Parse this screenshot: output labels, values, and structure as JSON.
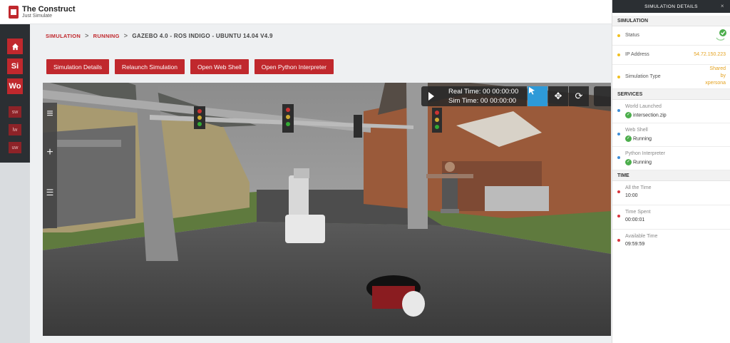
{
  "app": {
    "title": "The Construct",
    "subtitle": "Just Simulate"
  },
  "sidebar": {
    "home_icon": "home-icon",
    "workspaces": [
      {
        "label": "Si"
      },
      {
        "label": "Wo"
      }
    ],
    "shortcuts": [
      {
        "label": "sw"
      },
      {
        "label": "lw"
      },
      {
        "label": "uw"
      }
    ]
  },
  "breadcrumb": {
    "items": [
      "SIMULATION",
      "RUNNING"
    ],
    "current": "GAZEBO 4.0 - ROS INDIGO - UBUNTU 14.04 V4.9",
    "separator": ">"
  },
  "actions": [
    "Simulation Details",
    "Relaunch Simulation",
    "Open Web Shell",
    "Open Python Interpreter"
  ],
  "viewport": {
    "real_time": "Real Time: 00 00:00:00",
    "sim_time": "Sim Time: 00 00:00:00",
    "tools": [
      "menu-icon",
      "add-icon",
      "layers-icon"
    ],
    "toolbar": [
      "select-icon",
      "translate-icon",
      "rotate-icon"
    ]
  },
  "panel": {
    "title": "SIMULATION DETAILS",
    "close": "×",
    "sections": {
      "simulation": "SIMULATION",
      "services": "SERVICES",
      "time": "TIME"
    },
    "status_label": "Status",
    "ip_label": "IP Address",
    "ip_value": "54.72.150.223",
    "type_label": "Simulation Type",
    "type_value_1": "Shared",
    "type_value_2": "by",
    "type_value_3": "xpersona",
    "world_label": "World Launched",
    "world_value": "intersection.zip",
    "webshell_label": "Web Shell",
    "webshell_value": "Running",
    "python_label": "Python Interpreter",
    "python_value": "Running",
    "all_time_label": "All the Time",
    "all_time_value": "10:00",
    "spent_label": "Time Spent",
    "spent_value": "00:00:01",
    "available_label": "Available Time",
    "available_value": "09:59:59"
  },
  "colors": {
    "brand_red": "#c0282d",
    "dark": "#2b2f33",
    "accent_blue": "#2e9ad8",
    "ok_green": "#4cae4c",
    "value_orange": "#e4a21f"
  }
}
